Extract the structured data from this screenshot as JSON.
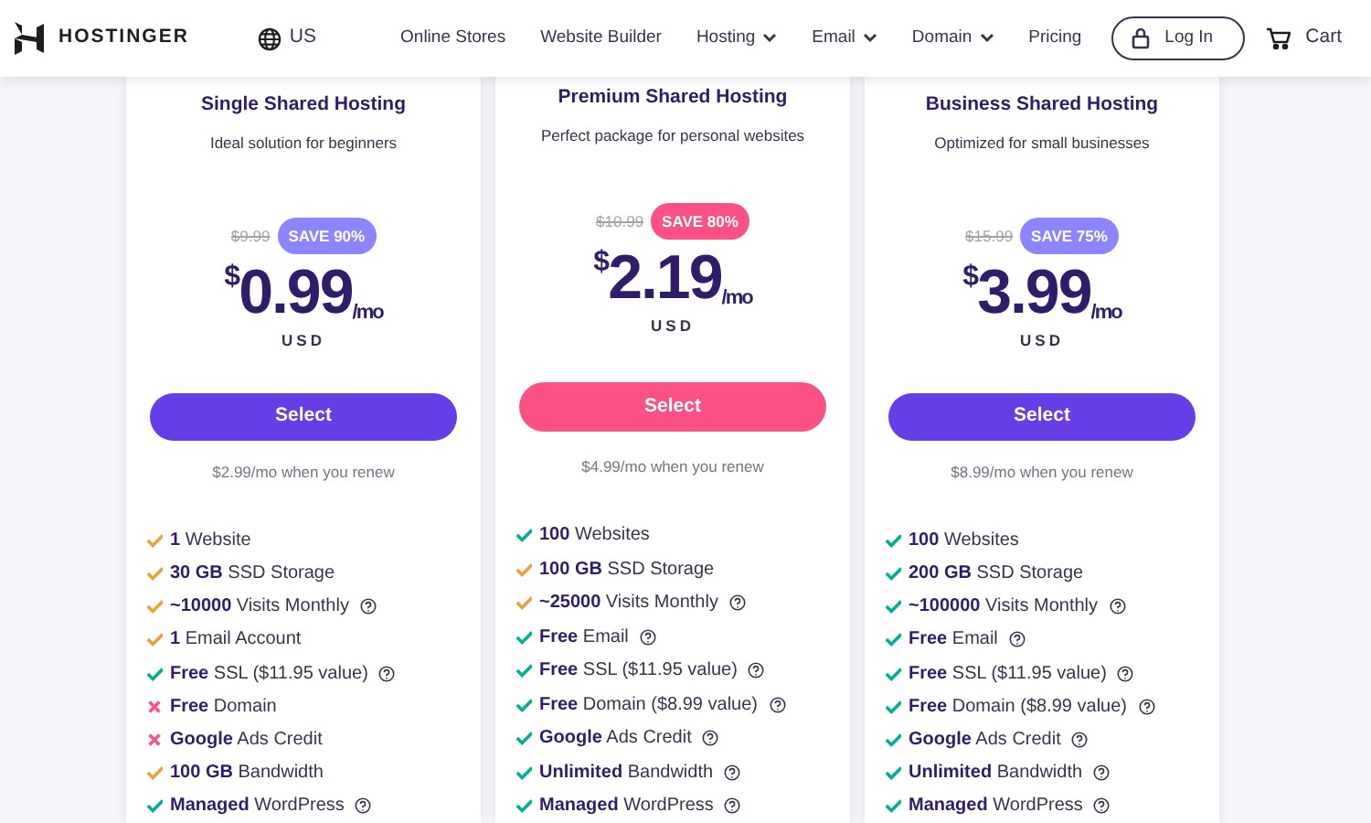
{
  "nav": {
    "brand": "HOSTINGER",
    "region": "US",
    "links": [
      {
        "label": "Online Stores",
        "dropdown": false
      },
      {
        "label": "Website Builder",
        "dropdown": false
      },
      {
        "label": "Hosting",
        "dropdown": true
      },
      {
        "label": "Email",
        "dropdown": true
      },
      {
        "label": "Domain",
        "dropdown": true
      },
      {
        "label": "Pricing",
        "dropdown": false
      }
    ],
    "login": "Log In",
    "cart": "Cart"
  },
  "plans": [
    {
      "title": "Single Shared Hosting",
      "subtitle": "Ideal solution for beginners",
      "old_price": "$9.99",
      "save": "SAVE 90%",
      "currency_sign": "$",
      "price": "0.99",
      "period": "/mo",
      "currency": "USD",
      "button": "Select",
      "featured": false,
      "renew": "$2.99/mo when you renew",
      "features": [
        {
          "text": "**1** Website",
          "kind": "partial",
          "help": false
        },
        {
          "text": "**30 GB** SSD Storage",
          "kind": "partial",
          "help": false
        },
        {
          "text": "**~10000** Visits Monthly",
          "kind": "partial",
          "help": true
        },
        {
          "text": "**1** Email Account",
          "kind": "partial",
          "help": false
        },
        {
          "text": "**Free** SSL ($11.95 value)",
          "kind": "check",
          "help": true
        },
        {
          "text": "**Free** Domain",
          "kind": "cross",
          "help": false
        },
        {
          "text": "**Google** Ads Credit",
          "kind": "cross",
          "help": false
        },
        {
          "text": "**100 GB** Bandwidth",
          "kind": "partial",
          "help": false
        },
        {
          "text": "**Managed** WordPress",
          "kind": "check",
          "help": true
        }
      ]
    },
    {
      "title": "Premium Shared Hosting",
      "subtitle": "Perfect package for personal websites",
      "old_price": "$10.99",
      "save": "SAVE 80%",
      "currency_sign": "$",
      "price": "2.19",
      "period": "/mo",
      "currency": "USD",
      "button": "Select",
      "featured": true,
      "renew": "$4.99/mo when you renew",
      "features": [
        {
          "text": "**100** Websites",
          "kind": "check",
          "help": false
        },
        {
          "text": "**100 GB** SSD Storage",
          "kind": "partial",
          "help": false
        },
        {
          "text": "**~25000** Visits Monthly",
          "kind": "partial",
          "help": true
        },
        {
          "text": "**Free** Email",
          "kind": "check",
          "help": true
        },
        {
          "text": "**Free** SSL ($11.95 value)",
          "kind": "check",
          "help": true
        },
        {
          "text": "**Free** Domain ($8.99 value)",
          "kind": "check",
          "help": true
        },
        {
          "text": "**Google** Ads Credit",
          "kind": "check",
          "help": true
        },
        {
          "text": "**Unlimited** Bandwidth",
          "kind": "check",
          "help": true
        },
        {
          "text": "**Managed** WordPress",
          "kind": "check",
          "help": true
        }
      ]
    },
    {
      "title": "Business Shared Hosting",
      "subtitle": "Optimized for small businesses",
      "old_price": "$15.99",
      "save": "SAVE 75%",
      "currency_sign": "$",
      "price": "3.99",
      "period": "/mo",
      "currency": "USD",
      "button": "Select",
      "featured": false,
      "renew": "$8.99/mo when you renew",
      "features": [
        {
          "text": "**100** Websites",
          "kind": "check",
          "help": false
        },
        {
          "text": "**200 GB** SSD Storage",
          "kind": "check",
          "help": false
        },
        {
          "text": "**~100000** Visits Monthly",
          "kind": "check",
          "help": true
        },
        {
          "text": "**Free** Email",
          "kind": "check",
          "help": true
        },
        {
          "text": "**Free** SSL ($11.95 value)",
          "kind": "check",
          "help": true
        },
        {
          "text": "**Free** Domain ($8.99 value)",
          "kind": "check",
          "help": true
        },
        {
          "text": "**Google** Ads Credit",
          "kind": "check",
          "help": true
        },
        {
          "text": "**Unlimited** Bandwidth",
          "kind": "check",
          "help": true
        },
        {
          "text": "**Managed** WordPress",
          "kind": "check",
          "help": true
        }
      ]
    }
  ]
}
